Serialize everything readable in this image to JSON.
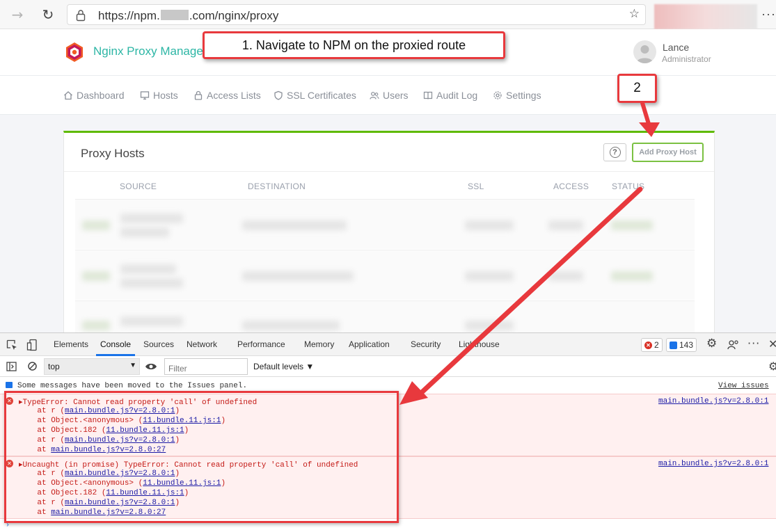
{
  "browser": {
    "url_prefix": "https://npm.",
    "url_suffix": ".com/nginx/proxy",
    "menu_glyph": "···"
  },
  "app": {
    "brand": "Nginx Proxy Manager",
    "user_name": "Lance",
    "user_role": "Administrator"
  },
  "nav": [
    {
      "label": "Dashboard",
      "icon": "home-icon"
    },
    {
      "label": "Hosts",
      "icon": "monitor-icon"
    },
    {
      "label": "Access Lists",
      "icon": "lock-icon"
    },
    {
      "label": "SSL Certificates",
      "icon": "shield-icon"
    },
    {
      "label": "Users",
      "icon": "users-icon"
    },
    {
      "label": "Audit Log",
      "icon": "book-icon"
    },
    {
      "label": "Settings",
      "icon": "gear-icon"
    }
  ],
  "card": {
    "title": "Proxy Hosts",
    "help_label": "?",
    "add_button": "Add Proxy Host",
    "columns": [
      "SOURCE",
      "DESTINATION",
      "SSL",
      "ACCESS",
      "STATUS"
    ]
  },
  "devtools": {
    "tabs": [
      "Elements",
      "Console",
      "Sources",
      "Network",
      "Performance",
      "Memory",
      "Application",
      "Security",
      "Lighthouse"
    ],
    "active_tab": "Console",
    "error_count": "2",
    "message_count": "143",
    "context": "top",
    "filter_placeholder": "Filter",
    "levels": "Default levels ▼",
    "info_message": "Some messages have been moved to the Issues panel.",
    "view_issues": "View issues",
    "errors": [
      {
        "message": "TypeError: Cannot read property 'call' of undefined",
        "source": "main.bundle.js?v=2.8.0:1",
        "stack": [
          {
            "prefix": "    at r (",
            "link": "main.bundle.js?v=2.8.0:1",
            "suffix": ")"
          },
          {
            "prefix": "    at Object.<anonymous> (",
            "link": "11.bundle.11.js:1",
            "suffix": ")"
          },
          {
            "prefix": "    at Object.182 (",
            "link": "11.bundle.11.js:1",
            "suffix": ")"
          },
          {
            "prefix": "    at r (",
            "link": "main.bundle.js?v=2.8.0:1",
            "suffix": ")"
          },
          {
            "prefix": "    at ",
            "link": "main.bundle.js?v=2.8.0:27",
            "suffix": ""
          }
        ]
      },
      {
        "message": "Uncaught (in promise) TypeError: Cannot read property 'call' of undefined",
        "source": "main.bundle.js?v=2.8.0:1",
        "stack": [
          {
            "prefix": "    at r (",
            "link": "main.bundle.js?v=2.8.0:1",
            "suffix": ")"
          },
          {
            "prefix": "    at Object.<anonymous> (",
            "link": "11.bundle.11.js:1",
            "suffix": ")"
          },
          {
            "prefix": "    at Object.182 (",
            "link": "11.bundle.11.js:1",
            "suffix": ")"
          },
          {
            "prefix": "    at r (",
            "link": "main.bundle.js?v=2.8.0:1",
            "suffix": ")"
          },
          {
            "prefix": "    at ",
            "link": "main.bundle.js?v=2.8.0:27",
            "suffix": ""
          }
        ]
      }
    ]
  },
  "annotations": {
    "step1": "1. Navigate to NPM on the proxied route",
    "step2": "2",
    "color": "#e8393d"
  }
}
